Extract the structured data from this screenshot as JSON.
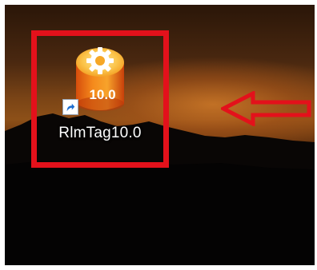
{
  "desktop": {
    "shortcut": {
      "label": "RlmTag10.0",
      "icon": "rlmtag-app-icon",
      "badge_text": "10.0",
      "overlay_icon": "shortcut-arrow-icon"
    },
    "annotation": {
      "highlight_color": "#e3111b",
      "pointer": "left-arrow-icon"
    }
  }
}
